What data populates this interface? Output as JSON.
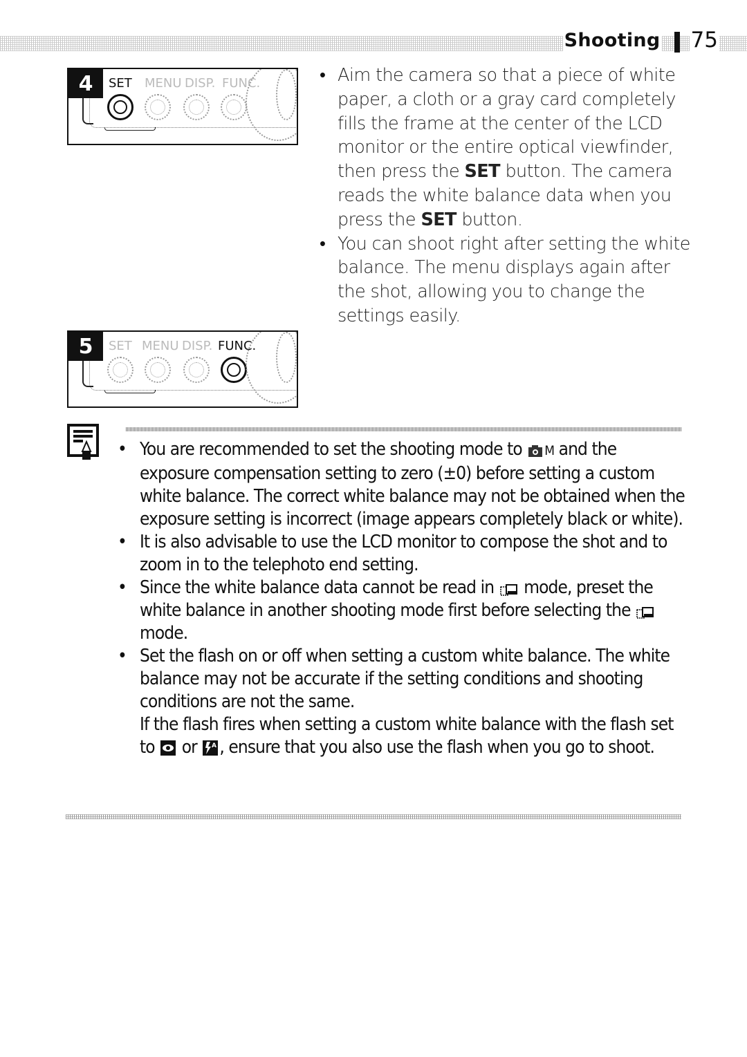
{
  "header": {
    "section": "Shooting",
    "page_number": "75"
  },
  "steps": [
    {
      "number": "4",
      "buttons": [
        {
          "label": "SET",
          "active": true
        },
        {
          "label": "MENU",
          "active": false
        },
        {
          "label": "DISP.",
          "active": false
        },
        {
          "label": "FUNC.",
          "active": false
        }
      ]
    },
    {
      "number": "5",
      "buttons": [
        {
          "label": "SET",
          "active": false
        },
        {
          "label": "MENU",
          "active": false
        },
        {
          "label": "DISP.",
          "active": false
        },
        {
          "label": "FUNC.",
          "active": true
        }
      ]
    }
  ],
  "instructions": {
    "item1_part1": "Aim the camera so that a piece of white paper, a cloth or a gray card completely fills the frame at the center of the LCD monitor or the entire optical viewfinder, then press the ",
    "item1_term1": "SET",
    "item1_part2": " button. The camera reads the white balance data when you press the ",
    "item1_term2": "SET",
    "item1_part3": " button.",
    "item2": "You can shoot right after setting the white balance. The menu displays again after the shot, allowing you to change the settings easily."
  },
  "notes": {
    "icon": "memo-pencil-icon",
    "item1_part1": "You are recommended to set the shooting mode to ",
    "item1_mode_icon": "camera-manual-mode-icon",
    "item1_mode_suffix": "M",
    "item1_part2": " and the exposure compensation setting to zero (±0) before setting a custom white balance. The correct white balance may not be obtained when the exposure setting is incorrect (image appears completely black or white).",
    "item2": "It is also advisable to use the LCD monitor to compose the shot and to zoom in to the telephoto end setting.",
    "item3_part1": "Since the white balance data cannot be read in ",
    "item3_mode_icon": "stitch-assist-mode-icon",
    "item3_part2": " mode, preset the white balance in another shooting mode first before selecting the ",
    "item3_part3": " mode.",
    "item4_line1": "Set the flash on or off when setting a custom white balance. The white balance may not be accurate if the setting conditions and shooting conditions are not the same.",
    "item4_line2_part1": "If the flash fires when setting a custom white balance with the flash set to ",
    "item4_icon1": "red-eye-reduction-icon",
    "item4_or": " or ",
    "item4_icon2": "auto-flash-icon",
    "item4_line2_part2": ", ensure that you also use the flash when you go to shoot."
  }
}
